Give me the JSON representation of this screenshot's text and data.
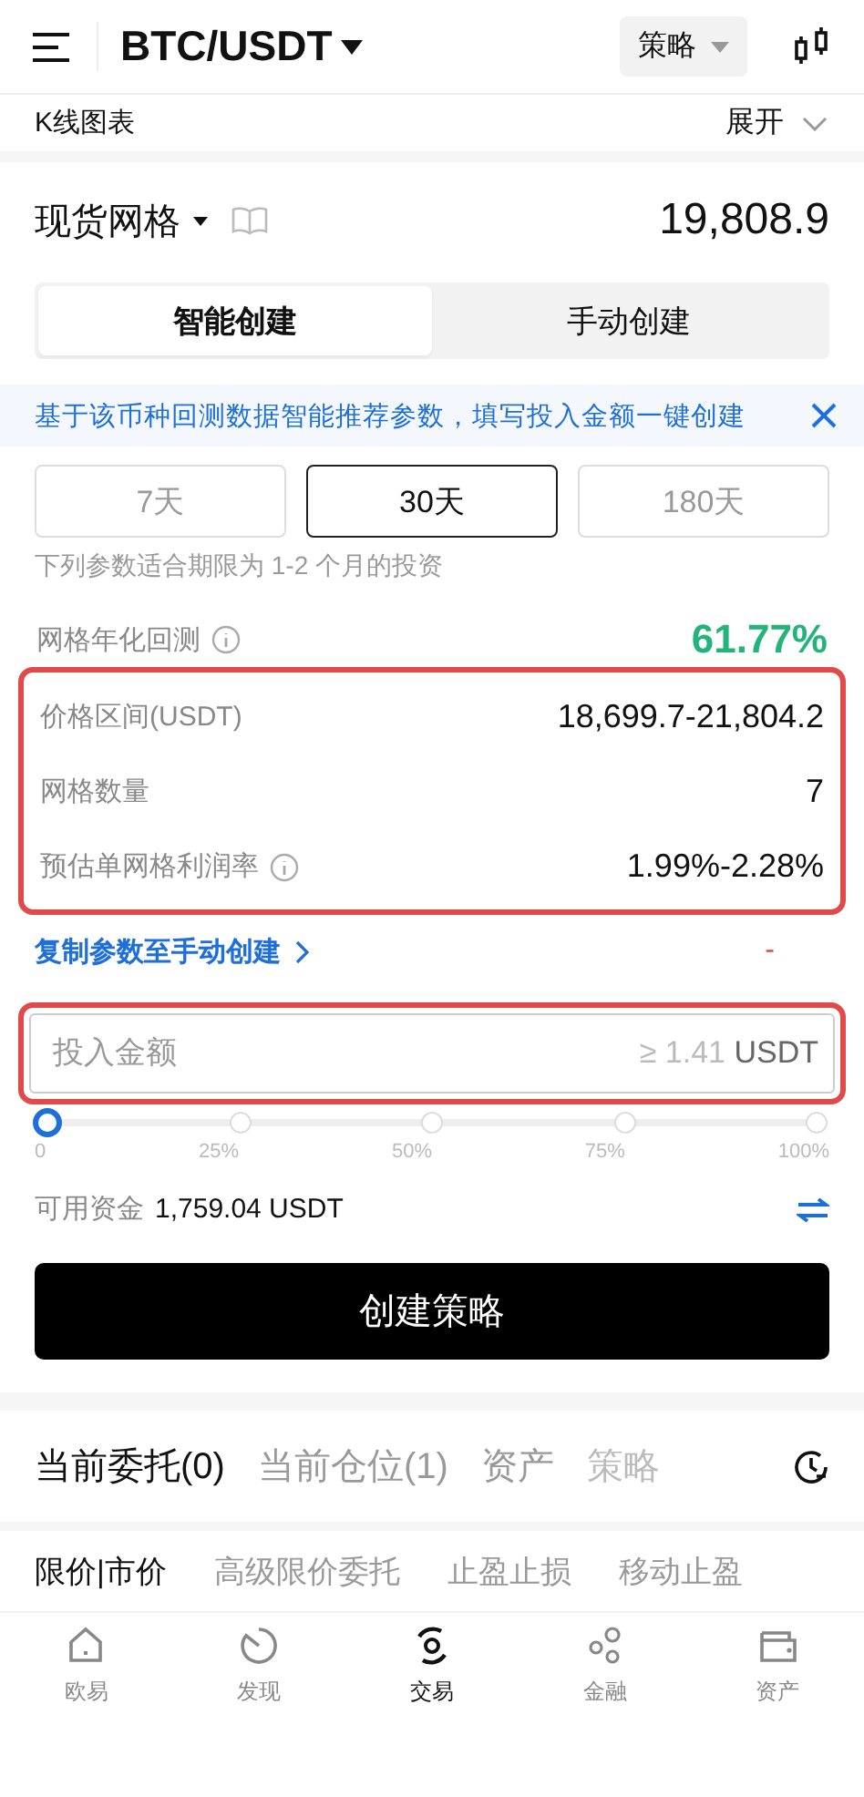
{
  "header": {
    "pair": "BTC/USDT",
    "strategy_button": "策略"
  },
  "chart_bar": {
    "label": "K线图表",
    "toggle": "展开"
  },
  "strategy": {
    "name": "现货网格",
    "price": "19,808.9"
  },
  "mode_tabs": [
    {
      "label": "智能创建",
      "selected": true
    },
    {
      "label": "手动创建",
      "selected": false
    }
  ],
  "banner": {
    "text": "基于该币种回测数据智能推荐参数，填写投入金额一键创建"
  },
  "periods": [
    {
      "label": "7天",
      "selected": false
    },
    {
      "label": "30天",
      "selected": true
    },
    {
      "label": "180天",
      "selected": false
    }
  ],
  "period_note": "下列参数适合期限为 1-2 个月的投资",
  "backtest": {
    "label": "网格年化回测",
    "value": "61.77%"
  },
  "params": {
    "highlighted": true,
    "rows": [
      {
        "label": "价格区间(USDT)",
        "value": "18,699.7-21,804.2",
        "info": false
      },
      {
        "label": "网格数量",
        "value": "7",
        "info": false
      },
      {
        "label": "预估单网格利润率",
        "value": "1.99%-2.28%",
        "info": true
      }
    ]
  },
  "copy_link": "复制参数至手动创建",
  "copy_value": "-",
  "amount": {
    "placeholder": "投入金额",
    "min_hint": "≥ 1.41",
    "unit": "USDT",
    "highlighted": true
  },
  "slider": {
    "level": 0,
    "ticks": [
      "0",
      "25%",
      "50%",
      "75%",
      "100%"
    ]
  },
  "available": {
    "label": "可用资金",
    "value": "1,759.04 USDT"
  },
  "create_button": "创建策略",
  "order_tabs": [
    {
      "label": "当前委托(0)",
      "selected": true
    },
    {
      "label": "当前仓位(1)",
      "selected": false
    },
    {
      "label": "资产",
      "selected": false
    },
    {
      "label": "策略",
      "selected": false
    }
  ],
  "order_types": [
    {
      "label": "限价|市价",
      "selected": true
    },
    {
      "label": "高级限价委托",
      "selected": false
    },
    {
      "label": "止盈止损",
      "selected": false
    },
    {
      "label": "移动止盈",
      "selected": false
    }
  ],
  "nav": [
    {
      "label": "欧易",
      "kind": "home",
      "selected": false
    },
    {
      "label": "发现",
      "kind": "discover",
      "selected": false
    },
    {
      "label": "交易",
      "kind": "trade",
      "selected": true
    },
    {
      "label": "金融",
      "kind": "finance",
      "selected": false
    },
    {
      "label": "资产",
      "kind": "wallet",
      "selected": false
    }
  ]
}
